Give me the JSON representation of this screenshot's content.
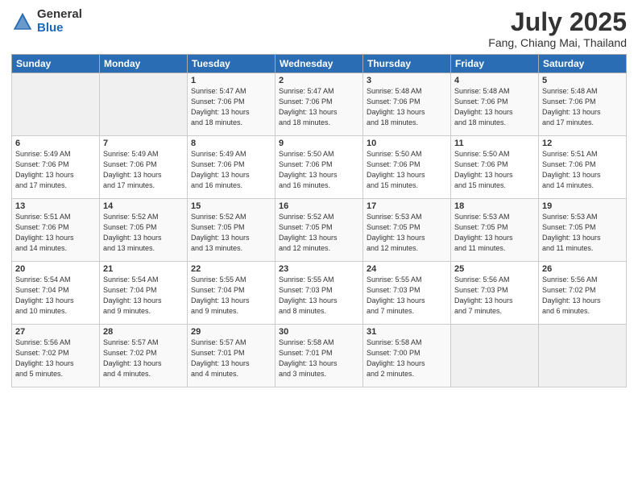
{
  "header": {
    "logo_line1": "General",
    "logo_line2": "Blue",
    "month_year": "July 2025",
    "location": "Fang, Chiang Mai, Thailand"
  },
  "calendar": {
    "days": [
      "Sunday",
      "Monday",
      "Tuesday",
      "Wednesday",
      "Thursday",
      "Friday",
      "Saturday"
    ],
    "weeks": [
      [
        {
          "num": "",
          "info": ""
        },
        {
          "num": "",
          "info": ""
        },
        {
          "num": "1",
          "info": "Sunrise: 5:47 AM\nSunset: 7:06 PM\nDaylight: 13 hours\nand 18 minutes."
        },
        {
          "num": "2",
          "info": "Sunrise: 5:47 AM\nSunset: 7:06 PM\nDaylight: 13 hours\nand 18 minutes."
        },
        {
          "num": "3",
          "info": "Sunrise: 5:48 AM\nSunset: 7:06 PM\nDaylight: 13 hours\nand 18 minutes."
        },
        {
          "num": "4",
          "info": "Sunrise: 5:48 AM\nSunset: 7:06 PM\nDaylight: 13 hours\nand 18 minutes."
        },
        {
          "num": "5",
          "info": "Sunrise: 5:48 AM\nSunset: 7:06 PM\nDaylight: 13 hours\nand 17 minutes."
        }
      ],
      [
        {
          "num": "6",
          "info": "Sunrise: 5:49 AM\nSunset: 7:06 PM\nDaylight: 13 hours\nand 17 minutes."
        },
        {
          "num": "7",
          "info": "Sunrise: 5:49 AM\nSunset: 7:06 PM\nDaylight: 13 hours\nand 17 minutes."
        },
        {
          "num": "8",
          "info": "Sunrise: 5:49 AM\nSunset: 7:06 PM\nDaylight: 13 hours\nand 16 minutes."
        },
        {
          "num": "9",
          "info": "Sunrise: 5:50 AM\nSunset: 7:06 PM\nDaylight: 13 hours\nand 16 minutes."
        },
        {
          "num": "10",
          "info": "Sunrise: 5:50 AM\nSunset: 7:06 PM\nDaylight: 13 hours\nand 15 minutes."
        },
        {
          "num": "11",
          "info": "Sunrise: 5:50 AM\nSunset: 7:06 PM\nDaylight: 13 hours\nand 15 minutes."
        },
        {
          "num": "12",
          "info": "Sunrise: 5:51 AM\nSunset: 7:06 PM\nDaylight: 13 hours\nand 14 minutes."
        }
      ],
      [
        {
          "num": "13",
          "info": "Sunrise: 5:51 AM\nSunset: 7:06 PM\nDaylight: 13 hours\nand 14 minutes."
        },
        {
          "num": "14",
          "info": "Sunrise: 5:52 AM\nSunset: 7:05 PM\nDaylight: 13 hours\nand 13 minutes."
        },
        {
          "num": "15",
          "info": "Sunrise: 5:52 AM\nSunset: 7:05 PM\nDaylight: 13 hours\nand 13 minutes."
        },
        {
          "num": "16",
          "info": "Sunrise: 5:52 AM\nSunset: 7:05 PM\nDaylight: 13 hours\nand 12 minutes."
        },
        {
          "num": "17",
          "info": "Sunrise: 5:53 AM\nSunset: 7:05 PM\nDaylight: 13 hours\nand 12 minutes."
        },
        {
          "num": "18",
          "info": "Sunrise: 5:53 AM\nSunset: 7:05 PM\nDaylight: 13 hours\nand 11 minutes."
        },
        {
          "num": "19",
          "info": "Sunrise: 5:53 AM\nSunset: 7:05 PM\nDaylight: 13 hours\nand 11 minutes."
        }
      ],
      [
        {
          "num": "20",
          "info": "Sunrise: 5:54 AM\nSunset: 7:04 PM\nDaylight: 13 hours\nand 10 minutes."
        },
        {
          "num": "21",
          "info": "Sunrise: 5:54 AM\nSunset: 7:04 PM\nDaylight: 13 hours\nand 9 minutes."
        },
        {
          "num": "22",
          "info": "Sunrise: 5:55 AM\nSunset: 7:04 PM\nDaylight: 13 hours\nand 9 minutes."
        },
        {
          "num": "23",
          "info": "Sunrise: 5:55 AM\nSunset: 7:03 PM\nDaylight: 13 hours\nand 8 minutes."
        },
        {
          "num": "24",
          "info": "Sunrise: 5:55 AM\nSunset: 7:03 PM\nDaylight: 13 hours\nand 7 minutes."
        },
        {
          "num": "25",
          "info": "Sunrise: 5:56 AM\nSunset: 7:03 PM\nDaylight: 13 hours\nand 7 minutes."
        },
        {
          "num": "26",
          "info": "Sunrise: 5:56 AM\nSunset: 7:02 PM\nDaylight: 13 hours\nand 6 minutes."
        }
      ],
      [
        {
          "num": "27",
          "info": "Sunrise: 5:56 AM\nSunset: 7:02 PM\nDaylight: 13 hours\nand 5 minutes."
        },
        {
          "num": "28",
          "info": "Sunrise: 5:57 AM\nSunset: 7:02 PM\nDaylight: 13 hours\nand 4 minutes."
        },
        {
          "num": "29",
          "info": "Sunrise: 5:57 AM\nSunset: 7:01 PM\nDaylight: 13 hours\nand 4 minutes."
        },
        {
          "num": "30",
          "info": "Sunrise: 5:58 AM\nSunset: 7:01 PM\nDaylight: 13 hours\nand 3 minutes."
        },
        {
          "num": "31",
          "info": "Sunrise: 5:58 AM\nSunset: 7:00 PM\nDaylight: 13 hours\nand 2 minutes."
        },
        {
          "num": "",
          "info": ""
        },
        {
          "num": "",
          "info": ""
        }
      ]
    ]
  }
}
